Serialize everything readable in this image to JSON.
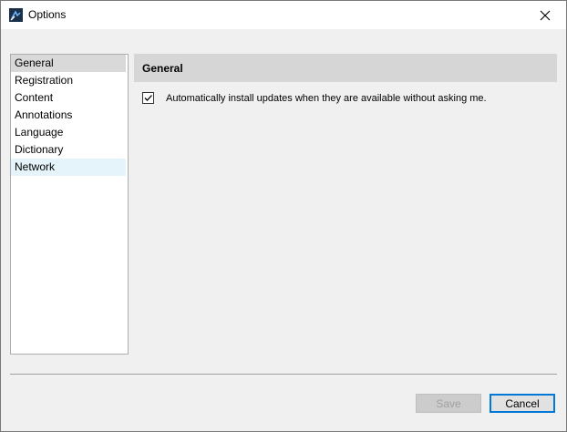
{
  "window": {
    "title": "Options"
  },
  "sidebar": {
    "items": [
      {
        "label": "General"
      },
      {
        "label": "Registration"
      },
      {
        "label": "Content"
      },
      {
        "label": "Annotations"
      },
      {
        "label": "Language"
      },
      {
        "label": "Dictionary"
      },
      {
        "label": "Network"
      }
    ],
    "selected": "General"
  },
  "panel": {
    "title": "General",
    "options": [
      {
        "label": "Automatically install updates when they are available without asking me.",
        "checked": true
      }
    ]
  },
  "buttons": {
    "save_label": "Save",
    "cancel_label": "Cancel"
  },
  "icons": {
    "app": "app-icon",
    "close": "close-icon",
    "check": "checkmark-icon"
  },
  "colors": {
    "titlebar": "#ffffff",
    "panel_header": "#d6d6d6",
    "selection": "#d9d9d9",
    "hover": "#e5f3fb",
    "focus_border": "#0078d7"
  }
}
